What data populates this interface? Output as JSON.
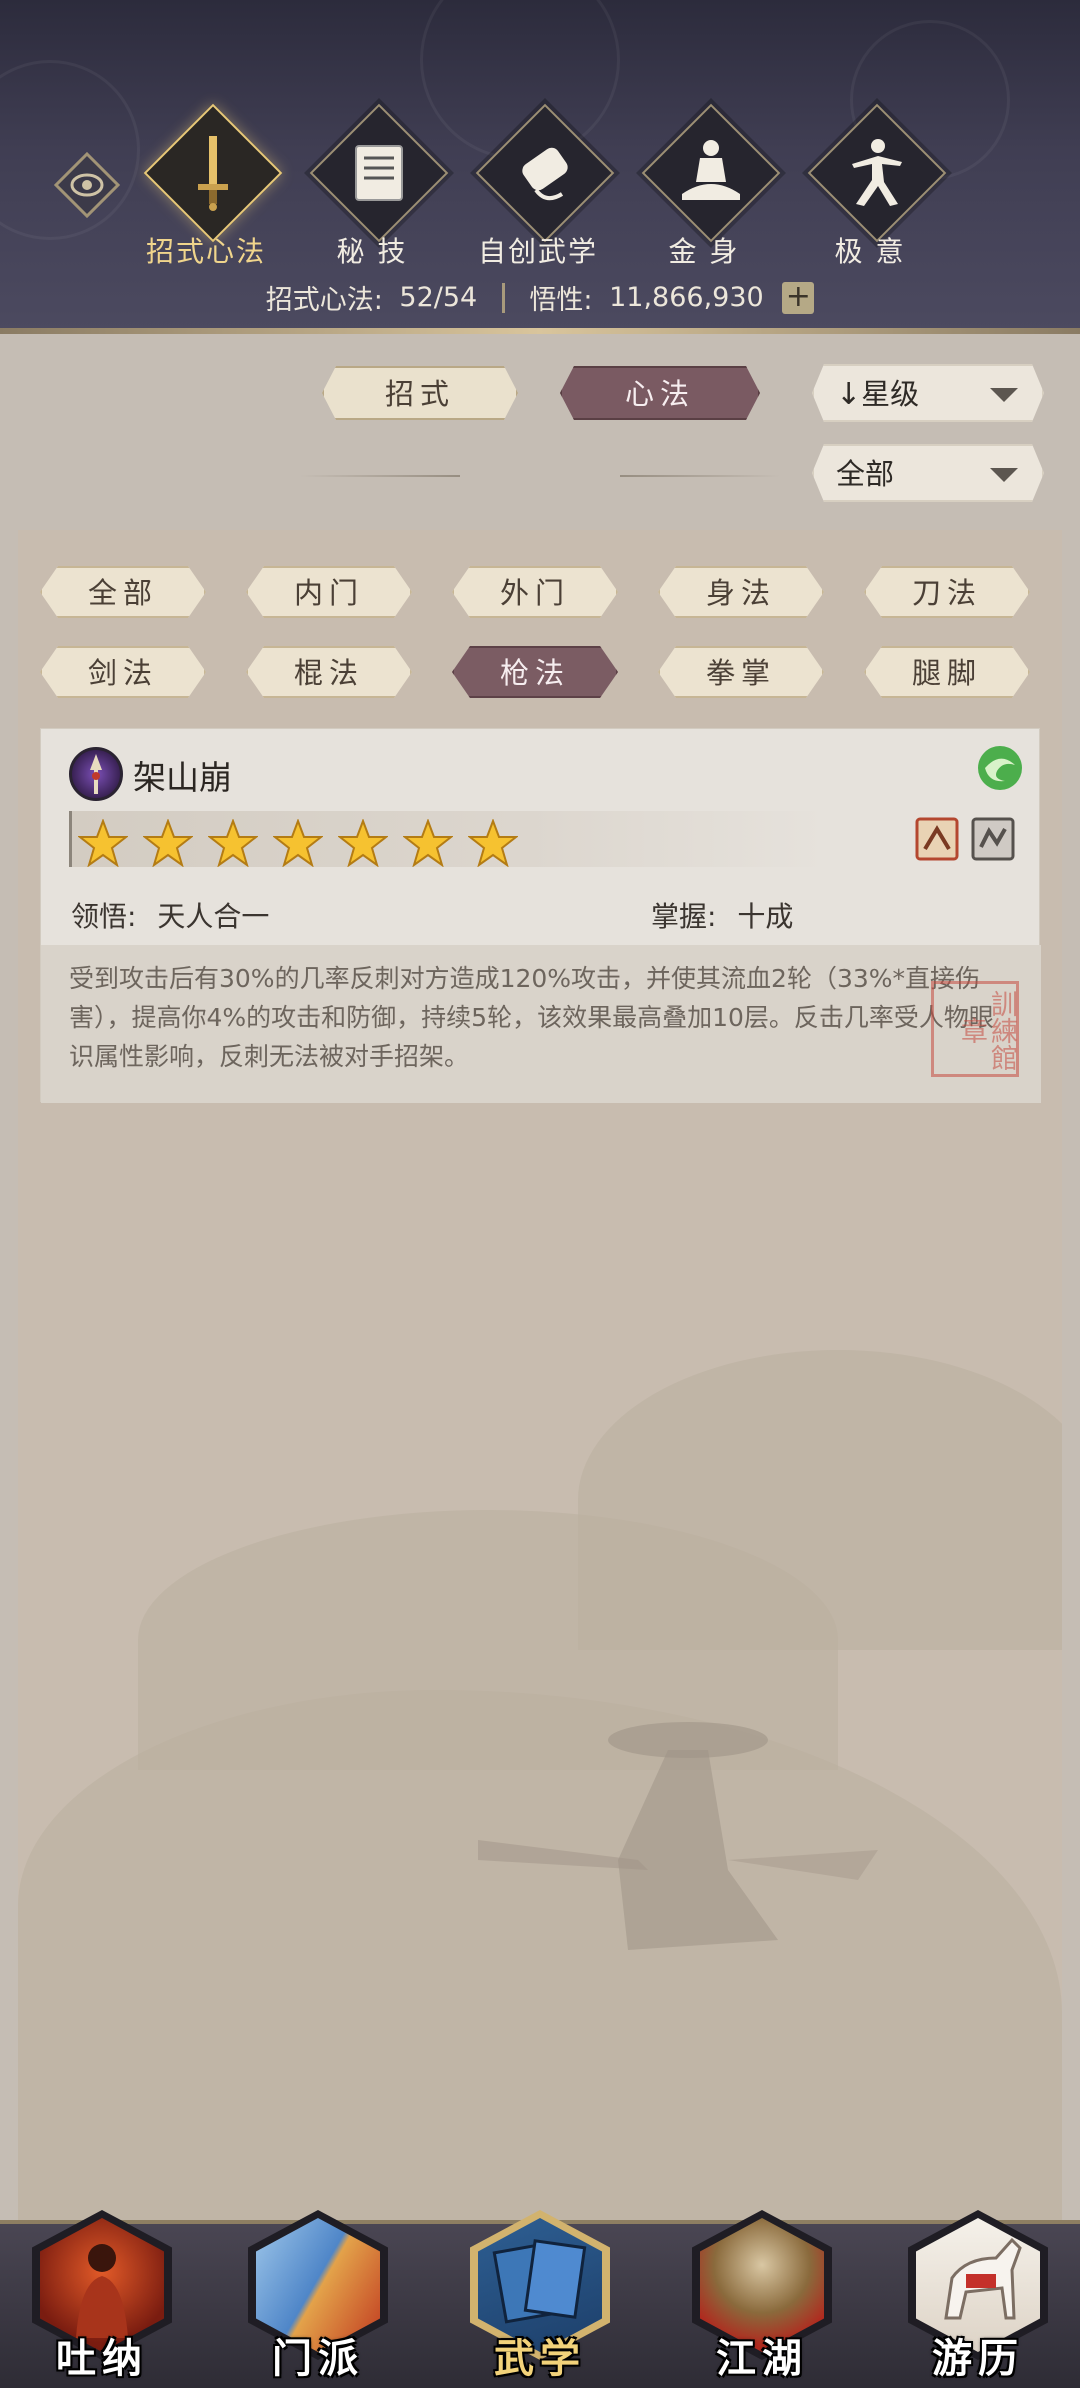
{
  "header": {
    "tabs": [
      {
        "label": "招式心法",
        "icon": "sword-icon",
        "active": true
      },
      {
        "label": "秘 技",
        "icon": "book-icon",
        "active": false
      },
      {
        "label": "自创武学",
        "icon": "scroll-icon",
        "active": false
      },
      {
        "label": "金 身",
        "icon": "meditation-icon",
        "active": false
      },
      {
        "label": "极 意",
        "icon": "martial-stance-icon",
        "active": false
      }
    ],
    "stats": {
      "collection_label": "招式心法:",
      "collection_value": "52/54",
      "insight_label": "悟性:",
      "insight_value": "11,866,930",
      "add": "+"
    }
  },
  "type_toggle": {
    "moves": "招式",
    "mind": "心法",
    "active": "mind"
  },
  "sort": {
    "selected": "星级",
    "arrow": "↓"
  },
  "scope": {
    "selected": "全部"
  },
  "filters": {
    "row1": [
      "全部",
      "内门",
      "外门",
      "身法",
      "刀法"
    ],
    "row2": [
      "剑法",
      "棍法",
      "枪法",
      "拳掌",
      "腿脚"
    ],
    "active": "枪法"
  },
  "skill": {
    "name": "架山崩",
    "icon": "spear-icon",
    "stars": 7,
    "comprehension_label": "领悟:",
    "comprehension_value": "天人合一",
    "mastery_label": "掌握:",
    "mastery_value": "十成",
    "description": "受到攻击后有30%的几率反刺对方造成120%攻击，并使其流血2轮（33%*直接伤害），提高你4%的攻击和防御，持续5轮，该效果最高叠加10层。反击几率受人物眼识属性影响，反刺无法被对手招架。",
    "stamp": "訓練館章"
  },
  "nav": [
    {
      "label": "吐纳",
      "icon": "monk-icon",
      "active": false
    },
    {
      "label": "门派",
      "icon": "sect-banner-icon",
      "active": false
    },
    {
      "label": "武学",
      "icon": "martial-books-icon",
      "active": true
    },
    {
      "label": "江湖",
      "icon": "straw-hat-icon",
      "active": false
    },
    {
      "label": "游历",
      "icon": "horse-icon",
      "active": false
    }
  ],
  "colors": {
    "header_bg": "#403e53",
    "active_gold": "#f0d58c",
    "active_tag": "#7a5a62",
    "panel_bg": "#c8bcaf"
  }
}
